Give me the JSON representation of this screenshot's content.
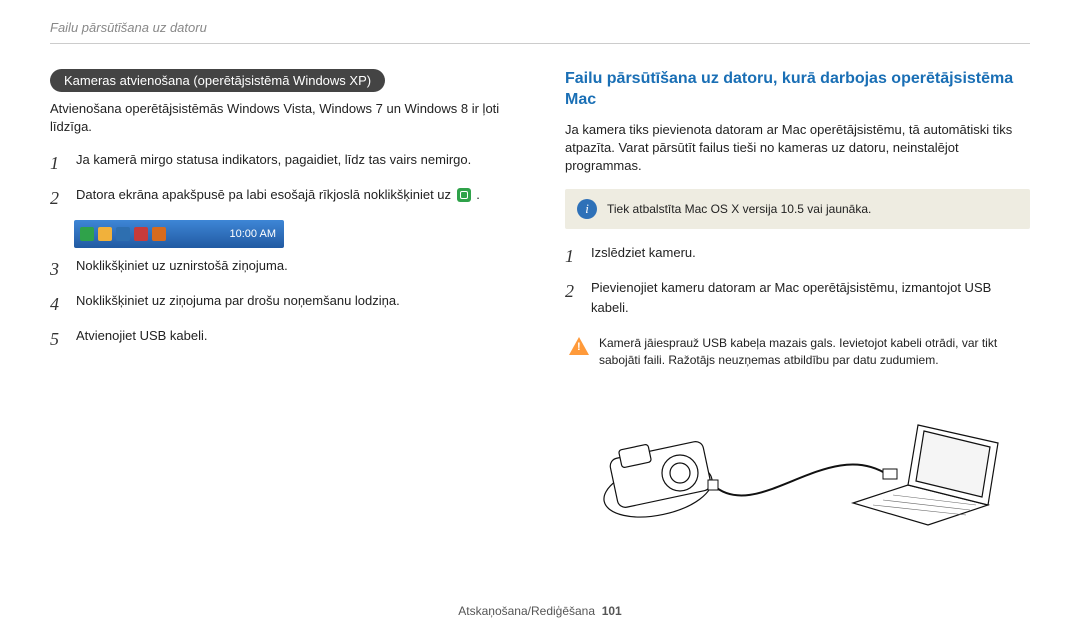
{
  "header": {
    "breadcrumb": "Failu pārsūtīšana uz datoru"
  },
  "left": {
    "pill": "Kameras atvienošana (operētājsistēmā Windows XP)",
    "intro": "Atvienošana operētājsistēmās Windows Vista, Windows 7 un Windows 8 ir ļoti līdzīga.",
    "steps": {
      "1": "Ja kamerā mirgo statusa indikators, pagaidiet, līdz tas vairs nemirgo.",
      "2": "Datora ekrāna apakšpusē pa labi esošajā rīkjoslā noklikšķiniet uz",
      "3": "Noklikšķiniet uz uznirstošā ziņojuma.",
      "4": "Noklikšķiniet uz ziņojuma par drošu noņemšanu lodziņa.",
      "5": "Atvienojiet USB kabeli."
    },
    "taskbar_time": "10:00 AM"
  },
  "right": {
    "title": "Failu pārsūtīšana uz datoru, kurā darbojas operētājsistēma Mac",
    "intro": "Ja kamera tiks pievienota datoram ar Mac operētājsistēmu, tā automātiski tiks atpazīta. Varat pārsūtīt failus tieši no kameras uz datoru, neinstalējot programmas.",
    "note": "Tiek atbalstīta Mac OS X versija 10.5 vai jaunāka.",
    "steps": {
      "1": "Izslēdziet kameru.",
      "2": "Pievienojiet kameru datoram ar Mac operētājsistēmu, izmantojot USB kabeli."
    },
    "warning": "Kamerā jāiesprauž USB kabeļa mazais gals. Ievietojot kabeli otrādi, var tikt sabojāti faili. Ražotājs neuzņemas atbildību par datu zudumiem."
  },
  "footer": {
    "section": "Atskaņošana/Rediģēšana",
    "page": "101"
  }
}
